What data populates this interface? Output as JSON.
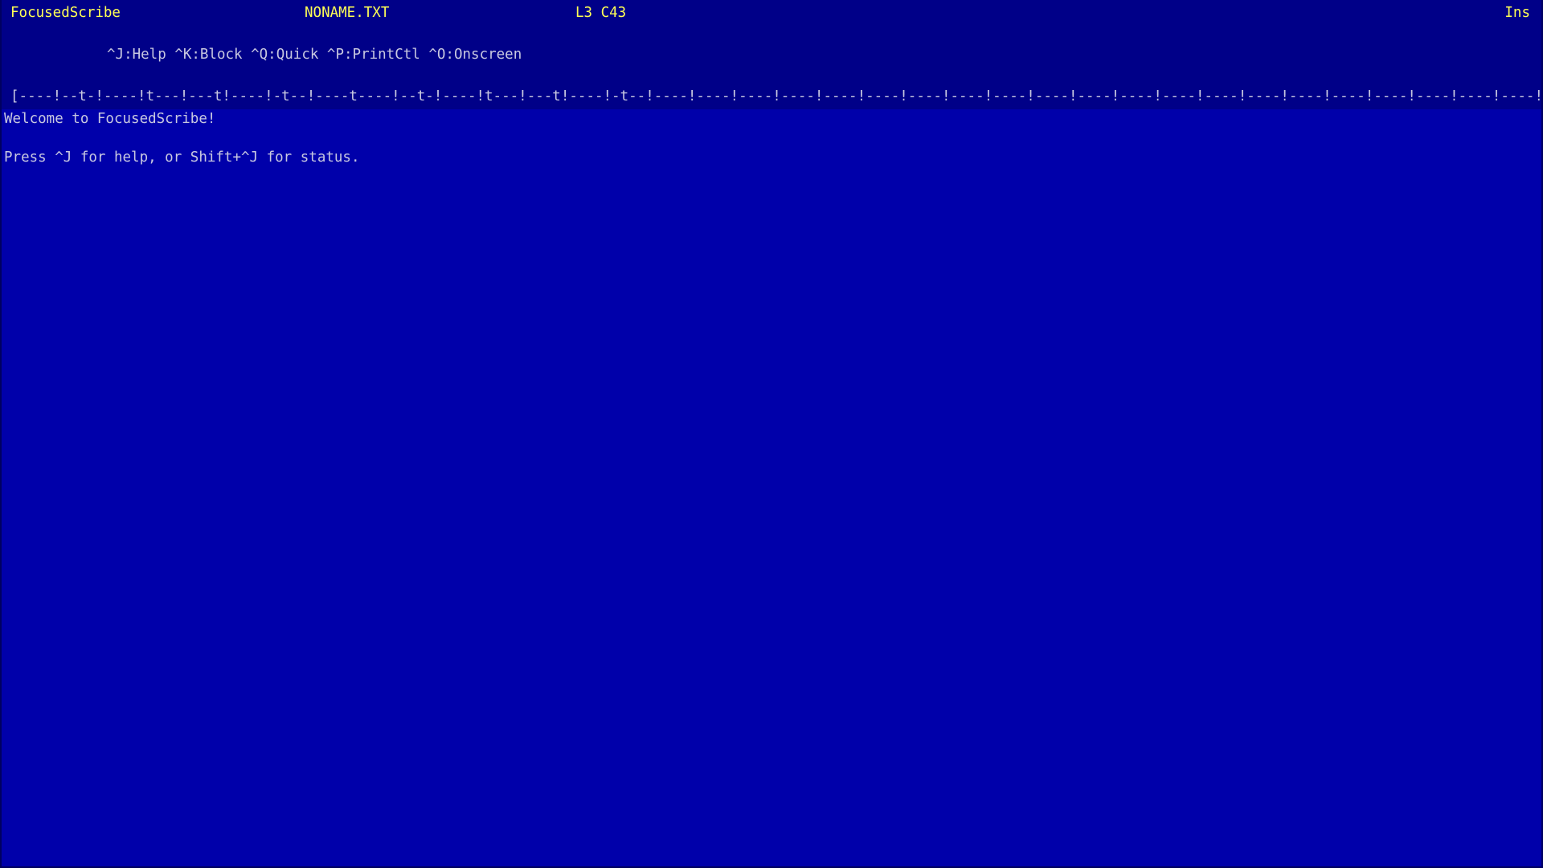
{
  "status": {
    "app_title": "FocusedScribe",
    "file_name": "NONAME.TXT",
    "cursor_position": "L3 C43",
    "mode": "Ins"
  },
  "menu": {
    "line": "^J:Help ^K:Block ^Q:Quick ^P:PrintCtl ^O:Onscreen"
  },
  "ruler": {
    "text": "[----!--t-!----!t---!---t!----!-t--!----t----!--t-!----!t---!---t!----!-t--!----!----!----!----!----!----!----!----!----!----!----!----!----!----!----!----!----!----!----!----!----!----!----!----!"
  },
  "document": {
    "lines": [
      "Welcome to FocusedScribe!",
      "",
      "Press ^J for help, or Shift+^J for status."
    ]
  },
  "colors": {
    "background": "#0000aa",
    "header_background": "#000088",
    "status_text": "#ffff55",
    "body_text": "#c8c8e0"
  }
}
